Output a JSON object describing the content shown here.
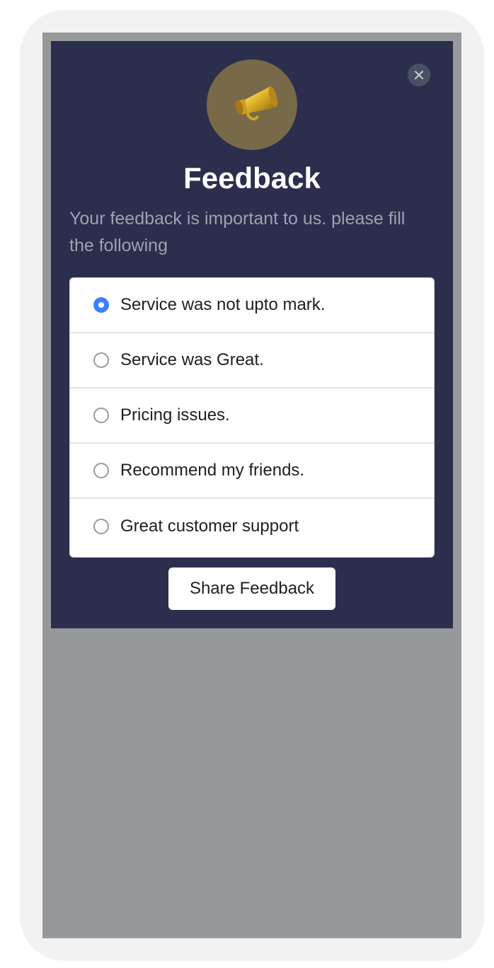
{
  "modal": {
    "close_icon": "close-icon",
    "hero_icon": "megaphone-icon",
    "title": "Feedback",
    "subtitle": "Your feedback is important to us. please fill the following",
    "options": [
      {
        "label": "Service was not upto mark.",
        "selected": true
      },
      {
        "label": "Service was Great.",
        "selected": false
      },
      {
        "label": "Pricing issues.",
        "selected": false
      },
      {
        "label": "Recommend my friends.",
        "selected": false
      },
      {
        "label": "Great customer support",
        "selected": false
      }
    ],
    "submit_label": "Share Feedback"
  },
  "colors": {
    "modal_bg": "#2b2f4d",
    "overlay": "#969a9d",
    "accent": "#3b82f6"
  }
}
